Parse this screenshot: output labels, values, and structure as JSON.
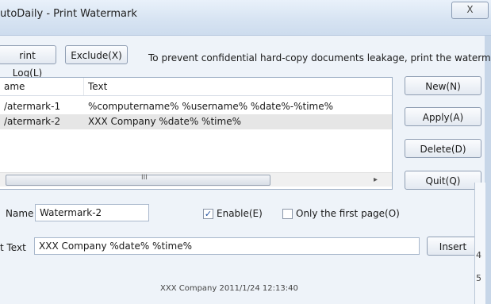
{
  "window": {
    "title": "utoDaily - Print Watermark",
    "close_label": "X"
  },
  "toolbar": {
    "print_log_label": "rint Log(L)",
    "exclude_label": "Exclude(X)",
    "hint": "To prevent confidential hard-copy documents leakage, print the watermark"
  },
  "list": {
    "columns": [
      "ame",
      "Text"
    ],
    "rows": [
      {
        "name": "/atermark-1",
        "text": "%computername% %username% %date%-%time%"
      },
      {
        "name": "/atermark-2",
        "text": "XXX Company %date%  %time%"
      }
    ],
    "selected_index": 1,
    "scroll_grip": "III"
  },
  "buttons": {
    "new": "New(N)",
    "apply": "Apply(A)",
    "delete": "Delete(D)",
    "quit": "Quit(Q)",
    "insert": "Insert"
  },
  "form": {
    "name_label": "Name",
    "name_value": "Watermark-2",
    "enable_label": "Enable(E)",
    "enable_checked": true,
    "first_page_label": "Only the first page(O)",
    "first_page_checked": false,
    "text_label": "t Text",
    "text_value": "XXX Company %date%  %time%"
  },
  "preview": "XXX Company 2011/1/24 12:13:40",
  "background_window": {
    "numbers": [
      "4",
      "5"
    ]
  }
}
